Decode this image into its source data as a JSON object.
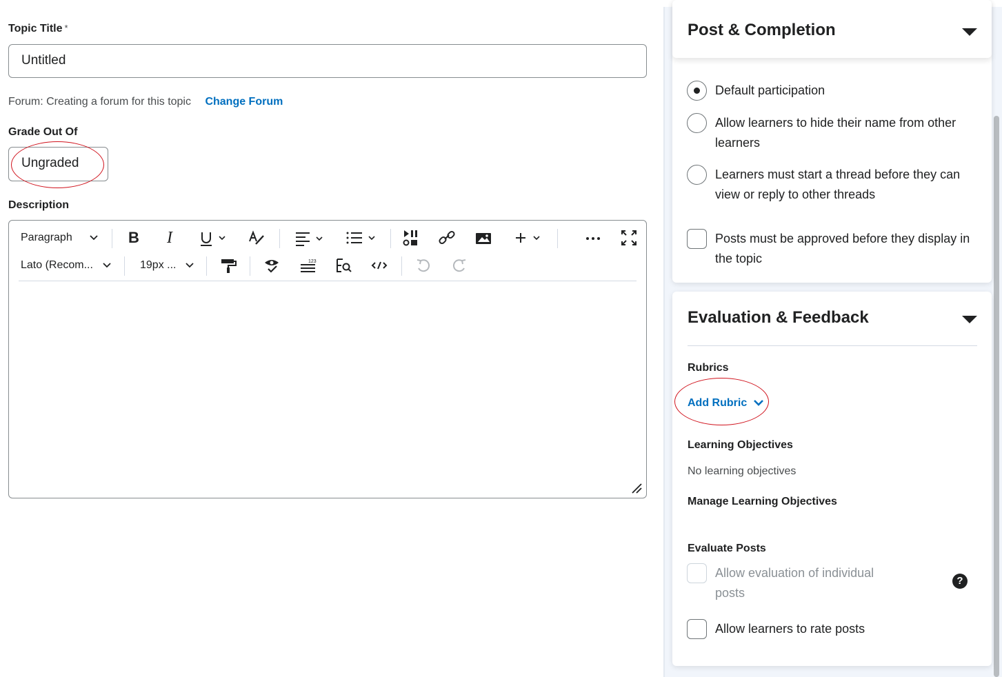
{
  "form": {
    "topic_title_label": "Topic Title",
    "required_mark": "*",
    "topic_title_value": "Untitled",
    "forum_text": "Forum: Creating a forum for this topic",
    "change_forum_link": "Change Forum",
    "grade_label": "Grade Out Of",
    "grade_value": "Ungraded",
    "description_label": "Description"
  },
  "editor": {
    "block_format": "Paragraph",
    "font_family": "Lato (Recom...",
    "font_size": "19px ...",
    "toolbar_row1": [
      "bold-icon",
      "italic-icon",
      "underline-icon",
      "text-color-icon",
      "align-icon",
      "list-icon",
      "media-icon",
      "link-icon",
      "image-icon",
      "insert-icon",
      "more-icon",
      "fullscreen-icon"
    ],
    "toolbar_row2": [
      "format-painter-icon",
      "spellcheck-icon",
      "word-count-icon",
      "preview-icon",
      "source-code-icon",
      "undo-icon",
      "redo-icon"
    ],
    "content": ""
  },
  "sidebar": {
    "post_completion": {
      "title": "Post & Completion",
      "options": [
        {
          "label": "Default participation",
          "checked": true
        },
        {
          "label": "Allow learners to hide their name from other learners",
          "checked": false
        },
        {
          "label": "Learners must start a thread before they can view or reply to other threads",
          "checked": false
        }
      ],
      "approval_checkbox": "Posts must be approved before they display in the topic"
    },
    "evaluation": {
      "title": "Evaluation & Feedback",
      "rubrics_label": "Rubrics",
      "add_rubric": "Add Rubric",
      "objectives_label": "Learning Objectives",
      "no_objectives": "No learning objectives",
      "manage_objectives": "Manage Learning Objectives",
      "evaluate_posts_label": "Evaluate Posts",
      "allow_evaluation": "Allow evaluation of individual posts",
      "allow_rating": "Allow learners to rate posts",
      "help_glyph": "?"
    }
  },
  "colors": {
    "link": "#006fbf",
    "annotation": "#d0111b",
    "sidebar_bg": "#f1f5fb"
  }
}
